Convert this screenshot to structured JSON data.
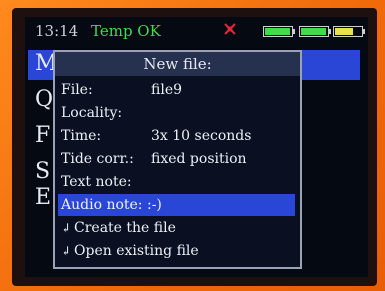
{
  "status": {
    "time": "13:14",
    "temp_status": "Temp OK",
    "gps_icon": "satellite-off-icon",
    "batteries": [
      {
        "level": 1.0,
        "color": "#3fdc4c"
      },
      {
        "level": 1.0,
        "color": "#3fdc4c"
      },
      {
        "level": 0.7,
        "color": "#e8e24c"
      }
    ]
  },
  "background_menu": {
    "items": [
      "M",
      "Q",
      "F",
      "S",
      "E"
    ],
    "selected_index": 0,
    "accent": "#2a46d6"
  },
  "dialog": {
    "title": "New file:",
    "fields": [
      {
        "label": "File:",
        "value": "file9"
      },
      {
        "label": "Locality:",
        "value": ""
      },
      {
        "label": "Time:",
        "value": "3x 10 seconds"
      },
      {
        "label": "Tide corr.:",
        "value": "fixed position"
      },
      {
        "label": "Text note:",
        "value": ""
      },
      {
        "label": "Audio note:",
        "value": ":-)"
      }
    ],
    "selected_field": 5,
    "actions": [
      {
        "icon": "enter-icon",
        "label": "Create the file"
      },
      {
        "icon": "enter-icon",
        "label": "Open existing file"
      }
    ]
  }
}
